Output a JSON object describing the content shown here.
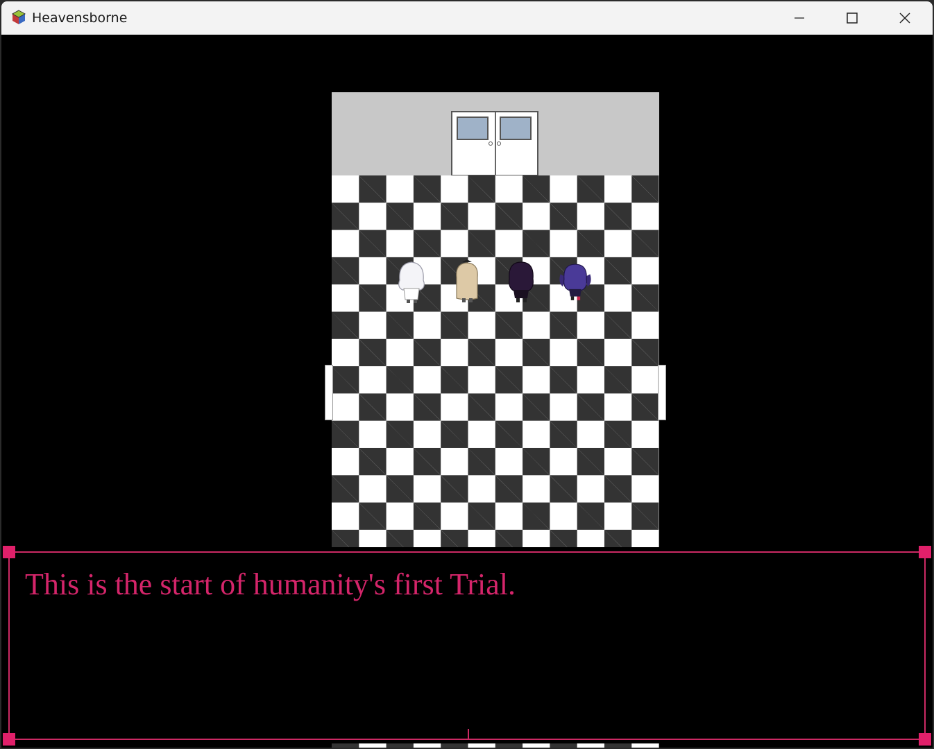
{
  "window": {
    "title": "Heavensborne",
    "icon": "game-cube-icon",
    "controls": [
      "minimize-icon",
      "maximize-icon",
      "close-icon"
    ]
  },
  "scene": {
    "room": "checkered trial room",
    "colors": {
      "wall": "#c8c8c8",
      "tile_dark": "#333333",
      "tile_light": "#ffffff",
      "accent": "#d4256a"
    },
    "characters": [
      "white-haired-character",
      "blonde-character",
      "dark-purple-haired-character",
      "purple-twintail-character"
    ]
  },
  "dialog": {
    "text": "This is the start of humanity's first Trial."
  }
}
